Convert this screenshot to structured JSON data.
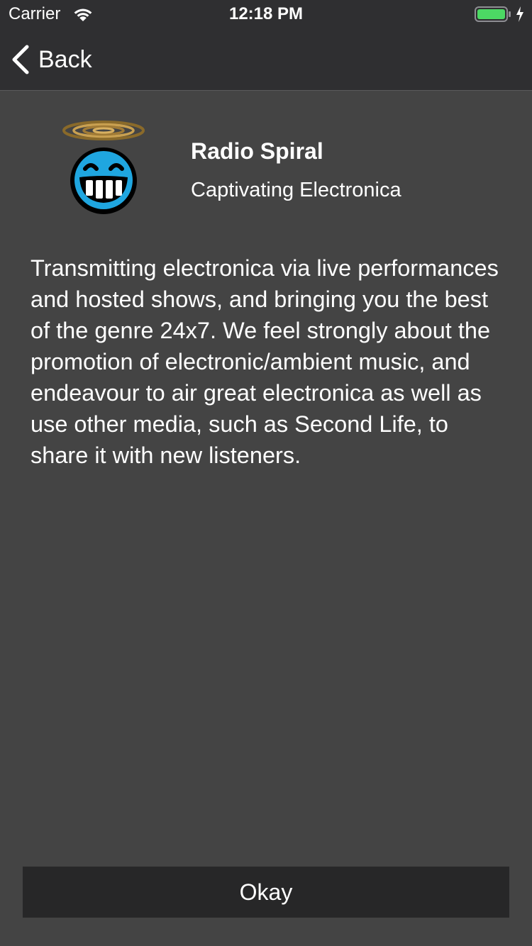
{
  "status_bar": {
    "carrier": "Carrier",
    "time": "12:18 PM",
    "icons": [
      "wifi-icon",
      "battery-icon",
      "charging-icon"
    ],
    "battery_color": "#4cd964"
  },
  "nav": {
    "back_label": "Back",
    "back_icon": "chevron-left-icon"
  },
  "station": {
    "name": "Radio Spiral",
    "tagline": "Captivating Electronica",
    "logo_icon": "grinning-face-with-halo-icon",
    "description": "Transmitting electronica via live performances and hosted shows, and bringing you the best of the genre 24x7. We feel strongly about the promotion of electronic/ambient music, and endeavour to air great electronica as well as use other media, such as Second Life, to share it with new listeners."
  },
  "actions": {
    "okay_label": "Okay"
  },
  "colors": {
    "background": "#444444",
    "topbar": "#2f2f31",
    "button": "#272728",
    "text": "#ffffff"
  }
}
